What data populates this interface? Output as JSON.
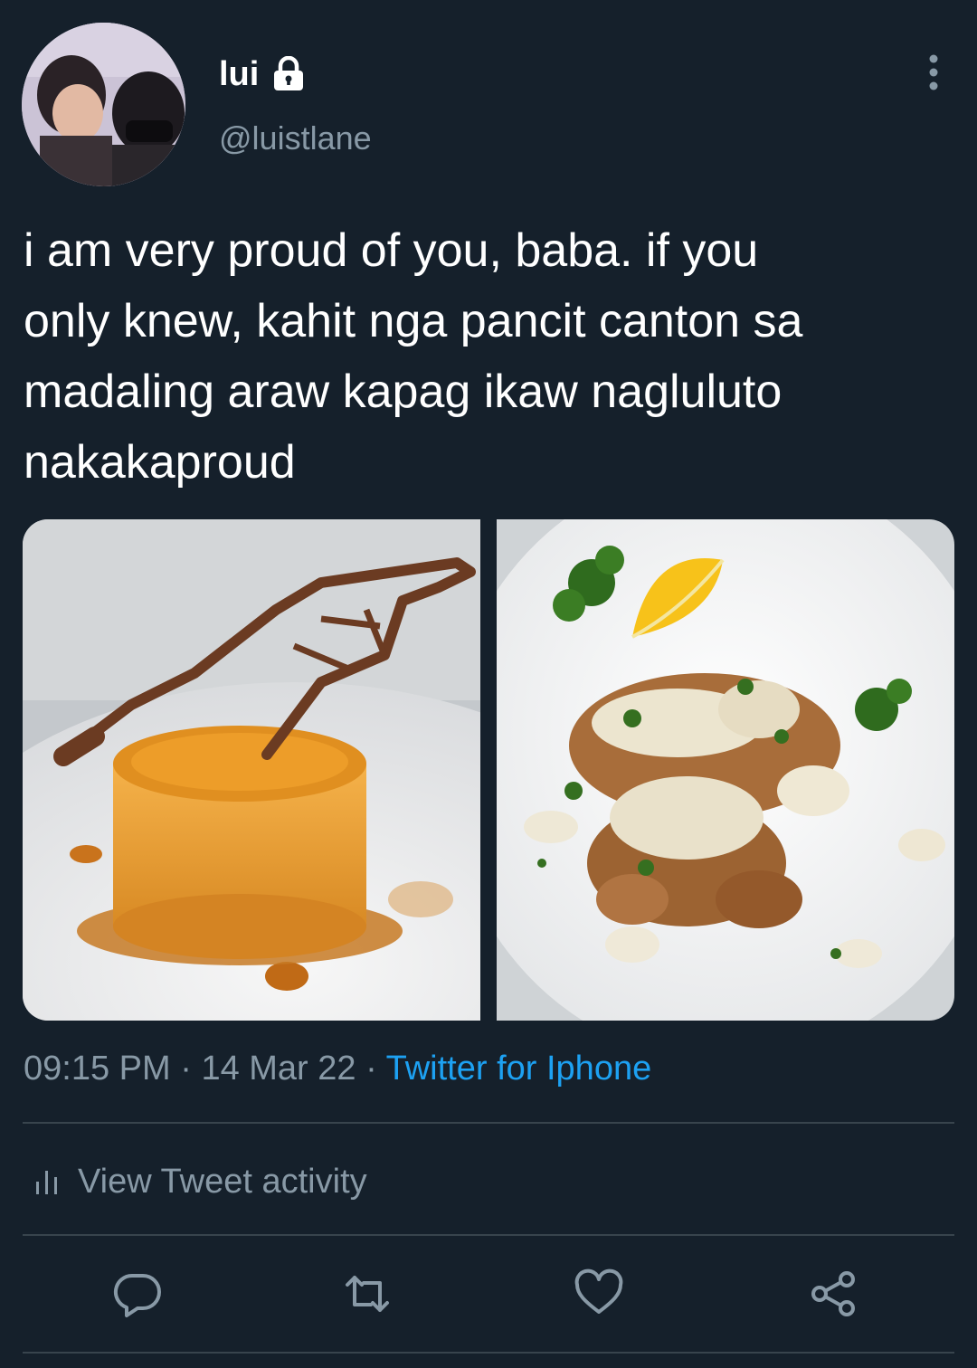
{
  "author": {
    "display_name": "lui",
    "handle": "@luistlane",
    "avatar_icon": "profile-photo",
    "lock_icon": "lock-icon"
  },
  "tweet": {
    "text": "i am very proud of you, baba. if you\nonly knew, kahit nga pancit canton sa\nmadaling araw kapag ikaw nagluluto\nnakakaproud",
    "photos": [
      {
        "icon": "leche-flan-photo"
      },
      {
        "icon": "fried-chicken-cream-sauce-photo"
      }
    ],
    "time": "09:15 PM",
    "separator": "·",
    "date": "14 Mar 22",
    "source": "Twitter for Iphone"
  },
  "activity": {
    "label": "View Tweet activity",
    "icon": "bar-chart-icon"
  },
  "actions": {
    "reply_icon": "reply-icon",
    "retweet_icon": "retweet-icon",
    "like_icon": "heart-icon",
    "share_icon": "share-icon"
  },
  "colors": {
    "background": "#15202b",
    "text_primary": "#ffffff",
    "text_secondary": "#8899a6",
    "link": "#1da1f2",
    "divider": "#38444d"
  }
}
